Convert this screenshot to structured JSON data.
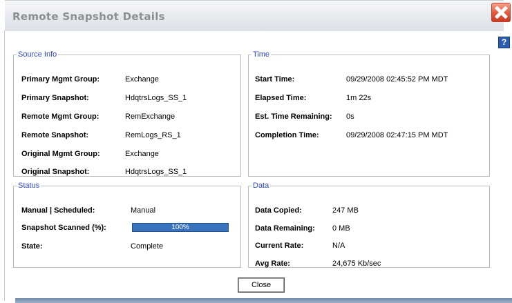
{
  "dialog": {
    "title": "Remote Snapshot Details",
    "help_label": "?",
    "close_button_label": "Close"
  },
  "source_info": {
    "legend": "Source Info",
    "rows": [
      {
        "label": "Primary Mgmt Group:",
        "value": "Exchange"
      },
      {
        "label": "Primary Snapshot:",
        "value": "HdqtrsLogs_SS_1"
      },
      {
        "label": "Remote Mgmt Group:",
        "value": "RemExchange"
      },
      {
        "label": "Remote Snapshot:",
        "value": "RemLogs_RS_1"
      },
      {
        "label": "Original Mgmt Group:",
        "value": "Exchange"
      },
      {
        "label": "Original Snapshot:",
        "value": "HdqtrsLogs_SS_1"
      }
    ]
  },
  "time": {
    "legend": "Time",
    "rows": [
      {
        "label": "Start Time:",
        "value": "09/29/2008 02:45:52 PM MDT"
      },
      {
        "label": "Elapsed Time:",
        "value": "1m 22s"
      },
      {
        "label": "Est. Time Remaining:",
        "value": "0s"
      },
      {
        "label": "Completion Time:",
        "value": "09/29/2008 02:47:15 PM MDT"
      }
    ]
  },
  "status": {
    "legend": "Status",
    "manual_label": "Manual | Scheduled:",
    "manual_value": "Manual",
    "scanned_label": "Snapshot Scanned (%):",
    "scanned_text": "100%",
    "scanned_fraction": 1.0,
    "state_label": "State:",
    "state_value": "Complete"
  },
  "data": {
    "legend": "Data",
    "rows": [
      {
        "label": "Data Copied:",
        "value": "247 MB"
      },
      {
        "label": "Data Remaining:",
        "value": "0 MB"
      },
      {
        "label": "Current Rate:",
        "value": "N/A"
      },
      {
        "label": "Avg Rate:",
        "value": "24,675 Kb/sec"
      }
    ]
  },
  "colors": {
    "legend_text": "#2a48c8",
    "progress_fill": "#3a73bd",
    "close_icon": "#e2563a"
  }
}
